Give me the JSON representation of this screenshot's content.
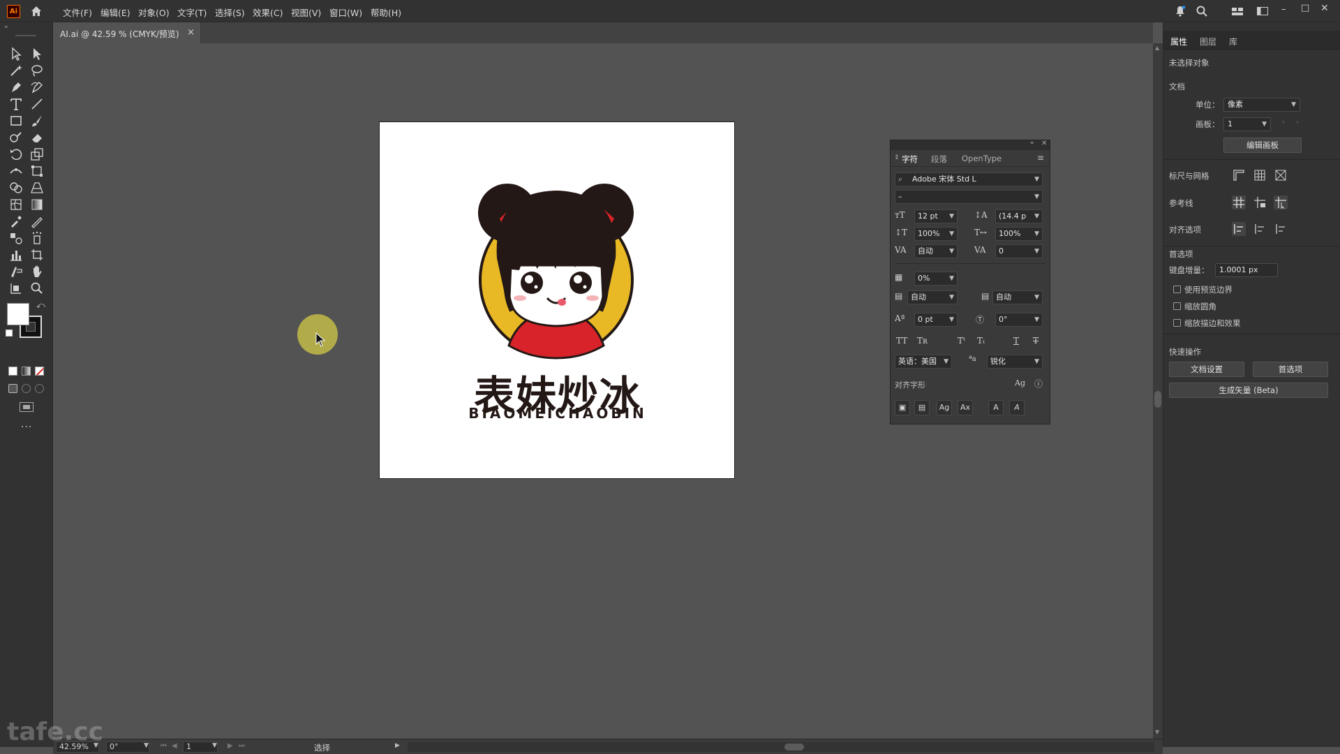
{
  "app": {
    "logo_text": "Ai",
    "menu": [
      "文件(F)",
      "编辑(E)",
      "对象(O)",
      "文字(T)",
      "选择(S)",
      "效果(C)",
      "视图(V)",
      "窗口(W)",
      "帮助(H)"
    ]
  },
  "document_tab": {
    "label": "AI.ai @ 42.59 % (CMYK/预览)",
    "close": "×"
  },
  "artboard": {
    "logo_title": "表妹炒冰",
    "logo_subtitle": "BIAOMEICHAOBIN",
    "colors": {
      "yellow": "#e9b925",
      "red": "#d8232a",
      "dark": "#231815"
    }
  },
  "character_panel": {
    "tabs": [
      "字符",
      "段落",
      "OpenType"
    ],
    "font_family": "Adobe 宋体 Std L",
    "font_style": "–",
    "font_size": "12 pt",
    "leading": "(14.4 p",
    "vertical_scale": "100%",
    "horizontal_scale": "100%",
    "kerning": "自动",
    "tracking": "0",
    "tsume": "0%",
    "aki_left": "自动",
    "aki_right": "自动",
    "baseline_shift": "0 pt",
    "rotation": "0°",
    "language": "英语：美国",
    "antialias": "锐化",
    "glyph_align_label": "对齐字形"
  },
  "properties": {
    "tabs": [
      "属性",
      "图层",
      "库"
    ],
    "no_selection": "未选择对象",
    "document_label": "文档",
    "unit_label": "单位：",
    "unit_value": "像素",
    "artboard_label": "画板：",
    "artboard_value": "1",
    "edit_artboard_btn": "编辑画板",
    "rulers_grids": "标尺与网格",
    "guides": "参考线",
    "snap_options": "对齐选项",
    "preferences": "首选项",
    "keyboard_increment_label": "键盘增量：",
    "keyboard_increment_value": "1.0001 px",
    "checkbox_preview_bounds": "使用预览边界",
    "checkbox_scale_corners": "缩放圆角",
    "checkbox_scale_strokes": "缩放描边和效果",
    "quick_actions": "快速操作",
    "doc_setup_btn": "文档设置",
    "prefs_btn": "首选项",
    "generate_vector_btn": "生成矢量 (Beta)"
  },
  "statusbar": {
    "zoom": "42.59%",
    "rotation": "0°",
    "artboard_num": "1",
    "tool": "选择"
  },
  "watermark": "tafe.cc"
}
